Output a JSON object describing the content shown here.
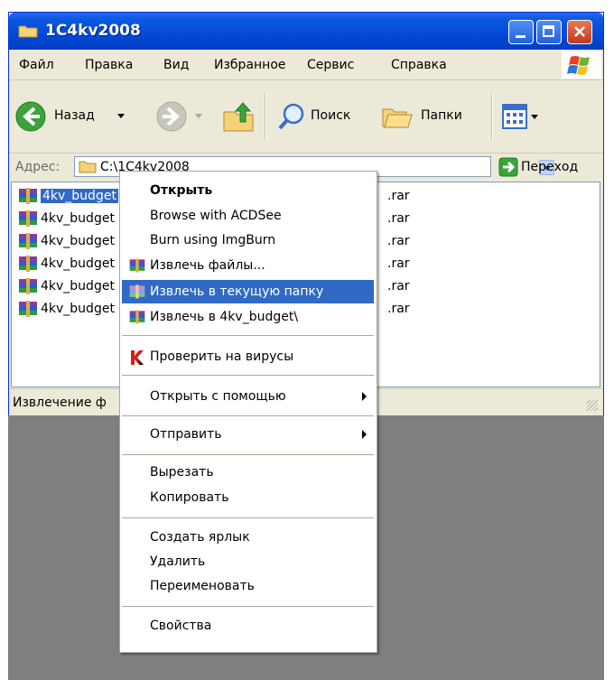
{
  "window": {
    "title": "1C4kv2008"
  },
  "menu": [
    "Файл",
    "Правка",
    "Вид",
    "Избранное",
    "Сервис",
    "Справка"
  ],
  "toolbar": {
    "back": "Назад",
    "search": "Поиск",
    "folders": "Папки"
  },
  "address": {
    "label": "Адрес:",
    "value": "C:\\1C4kv2008",
    "go": "Переход"
  },
  "files_left": [
    "4kv_budget",
    "4kv_budget",
    "4kv_budget",
    "4kv_budget",
    "4kv_budget",
    "4kv_budget"
  ],
  "files_right": [
    ".rar",
    ".rar",
    ".rar",
    ".rar",
    ".rar",
    ".rar"
  ],
  "status": "Извлечение ф",
  "context_menu": {
    "open": "Открыть",
    "acdsee": "Browse with ACDSee",
    "imgburn": "Burn using ImgBurn",
    "extract_files": "Извлечь файлы...",
    "extract_here": "Извлечь в текущую папку",
    "extract_to": "Извлечь в 4kv_budget\\",
    "scan": "Проверить на вирусы",
    "open_with": "Открыть с помощью",
    "send_to": "Отправить",
    "cut": "Вырезать",
    "copy": "Копировать",
    "shortcut": "Создать ярлык",
    "delete": "Удалить",
    "rename": "Переименовать",
    "properties": "Свойства"
  },
  "colors": {
    "titlebar": "#0249d6",
    "selection": "#316ac5",
    "desktop": "#7f7f7f"
  }
}
